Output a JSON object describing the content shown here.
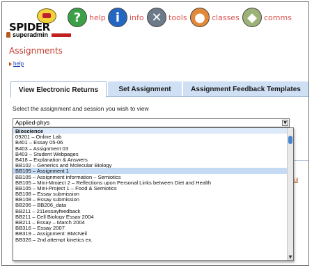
{
  "app": {
    "logo_text": "SPIDER",
    "user": "superadmin"
  },
  "nav": [
    {
      "label": "help",
      "glyph": "?"
    },
    {
      "label": "info",
      "glyph": "i"
    },
    {
      "label": "tools",
      "glyph": "✕"
    },
    {
      "label": "classes",
      "glyph": "●"
    },
    {
      "label": "comms",
      "glyph": "◆"
    }
  ],
  "section_title": "Assignments",
  "help_link": "help",
  "tabs": [
    {
      "label": "View Electronic Returns",
      "active": true
    },
    {
      "label": "Set Assignment",
      "active": false
    },
    {
      "label": "Assignment Feedback Templates",
      "active": false
    }
  ],
  "prompt": "Select the assignment and session you wish to view",
  "select": {
    "value": "Applied-phys"
  },
  "options": [
    {
      "label": "Bioscience",
      "group": true
    },
    {
      "label": "09201 – Online Lab"
    },
    {
      "label": "B401 – Essay 05-06"
    },
    {
      "label": "B403 – Assignment 03"
    },
    {
      "label": "B403 – Student Webpages"
    },
    {
      "label": "B418 – Explanation & Answers"
    },
    {
      "label": "BB102 – Generics and Molecular Biology"
    },
    {
      "label": "BB105 – Assignment 1",
      "selected": true
    },
    {
      "label": "BB105 – Assignment information – Semiotics"
    },
    {
      "label": "BB105 – Mini-Mroject 2 – Reflections upon Personal Links between Diet and Health"
    },
    {
      "label": "BB105 – Mini-Project 1 – Food & Semiotics"
    },
    {
      "label": "BB108 – Essay submission"
    },
    {
      "label": "BB108 – Essay submission"
    },
    {
      "label": "BB206 – BB206_data"
    },
    {
      "label": "BB211 – 211essayfeedback"
    },
    {
      "label": "BB211 – Cell Biology Essay 2004"
    },
    {
      "label": "BB211 – Essay – March 2004"
    },
    {
      "label": "BB316 – Essay 2007"
    },
    {
      "label": "BB319 – Assignment: BMcNeil"
    },
    {
      "label": "BB326 – 2nd attempt kinetics ex."
    }
  ],
  "behind_link": "ul"
}
